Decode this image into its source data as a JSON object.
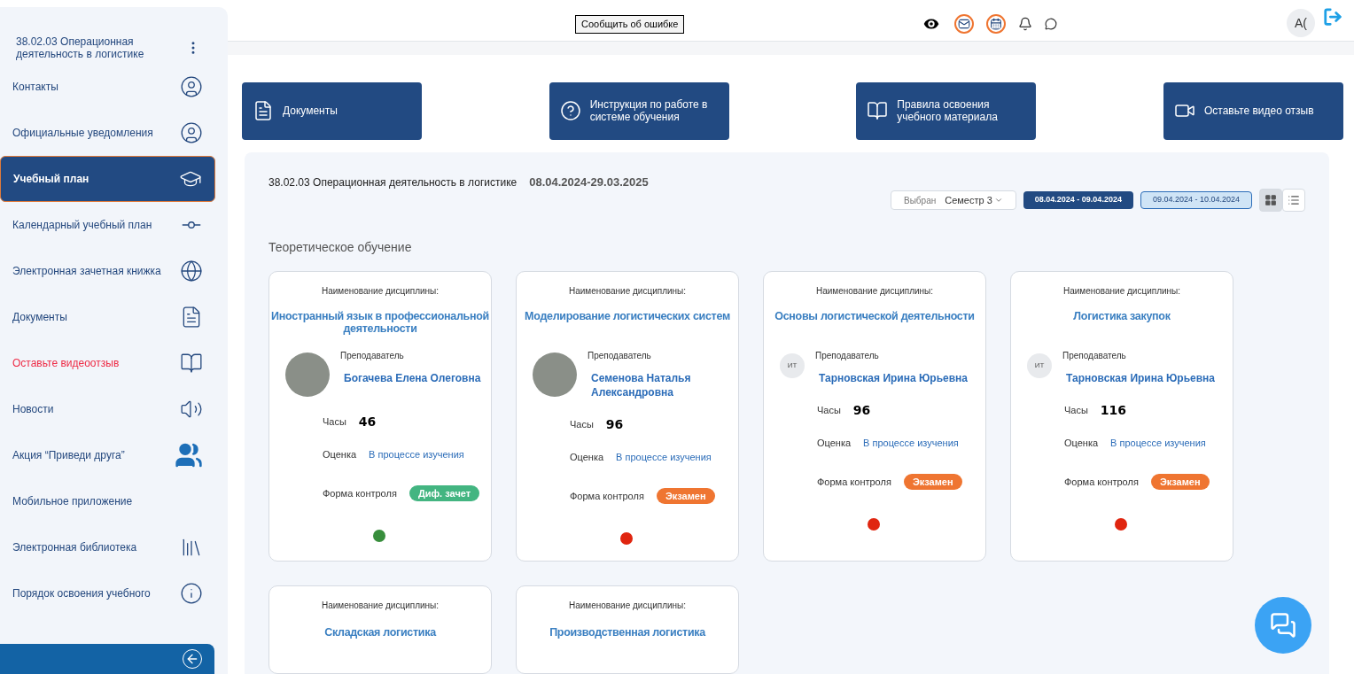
{
  "sidebar": {
    "program": "38.02.03 Операционная деятельность в логистике",
    "items": [
      {
        "label": "Контакты",
        "selected": false,
        "color": "#24487e"
      },
      {
        "label": "Официальные уведомления",
        "selected": false,
        "color": "#24487e"
      },
      {
        "label": "Учебный план",
        "selected": true,
        "color": "#ffffff"
      },
      {
        "label": "Календарный учебный план",
        "selected": false,
        "color": "#24487e"
      },
      {
        "label": "Электронная зачетная книжка",
        "selected": false,
        "color": "#24487e"
      },
      {
        "label": "Документы",
        "selected": false,
        "color": "#24487e"
      },
      {
        "label": "Оставьте видеоотзыв",
        "selected": false,
        "color": "#ee2a45"
      },
      {
        "label": "Новости",
        "selected": false,
        "color": "#24487e"
      },
      {
        "label": "Акция “Приведи друга”",
        "selected": false,
        "color": "#24487e"
      },
      {
        "label": "Мобильное приложение",
        "selected": false,
        "color": "#24487e"
      },
      {
        "label": "Электронная библиотека",
        "selected": false,
        "color": "#24487e"
      },
      {
        "label": "Порядок освоения учебного",
        "selected": false,
        "color": "#24487e"
      }
    ]
  },
  "header": {
    "report_button": "Сообщить об ошибке",
    "avatar": "А("
  },
  "quick_links": [
    {
      "label": "Документы"
    },
    {
      "label": "Инструкция по работе в системе обучения"
    },
    {
      "label": "Правила освоения учебного материала"
    },
    {
      "label": "Оставьте видео отзыв"
    }
  ],
  "plan": {
    "program": "38.02.03 Операционная деятельность в логистике",
    "period": "08.04.2024-29.03.2025",
    "semester_label": "Выбран",
    "semester": "Семестр 3",
    "ranges": [
      {
        "label": "08.04.2024 - 09.04.2024",
        "selected": true
      },
      {
        "label": "09.04.2024 - 10.04.2024",
        "selected": false
      }
    ],
    "views": [
      {
        "kind": "grid",
        "selected": true
      },
      {
        "kind": "list",
        "selected": false
      }
    ],
    "section": "Теоретическое обучение",
    "cards": [
      {
        "name_label": "Наименование дисциплины:",
        "name": "Иностранный язык в профессиональной деятельности",
        "teacher_label": "Преподаватель",
        "teacher": "Богачева Елена Олеговна",
        "hours_label": "Часы",
        "hours": "46",
        "grade_label": "Оценка",
        "grade": "В процессе изучения",
        "control_label": "Форма контроля",
        "control": {
          "label": "Диф. зачет",
          "color": "#43b581"
        },
        "status": {
          "color": "#388e3c"
        }
      },
      {
        "name_label": "Наименование дисциплины:",
        "name": "Моделирование логистических систем",
        "teacher_label": "Преподаватель",
        "teacher": "Семенова Наталья Александровна",
        "hours_label": "Часы",
        "hours": "96",
        "grade_label": "Оценка",
        "grade": "В процессе изучения",
        "control_label": "Форма контроля",
        "control": {
          "label": "Экзамен",
          "color": "#ef7531"
        },
        "status": {
          "color": "#e0250f"
        }
      },
      {
        "name_label": "Наименование дисциплины:",
        "name": "Основы логистической деятельности",
        "teacher_label": "Преподаватель",
        "teacher": "Тарновская Ирина Юрьевна",
        "initials": "ИТ",
        "hours_label": "Часы",
        "hours": "96",
        "grade_label": "Оценка",
        "grade": "В процессе изучения",
        "control_label": "Форма контроля",
        "control": {
          "label": "Экзамен",
          "color": "#ef7531"
        },
        "status": {
          "color": "#e0250f"
        }
      },
      {
        "name_label": "Наименование дисциплины:",
        "name": "Логистика закупок",
        "teacher_label": "Преподаватель",
        "teacher": "Тарновская Ирина Юрьевна",
        "initials": "ИТ",
        "hours_label": "Часы",
        "hours": "116",
        "grade_label": "Оценка",
        "grade": "В процессе изучения",
        "control_label": "Форма контроля",
        "control": {
          "label": "Экзамен",
          "color": "#ef7531"
        },
        "status": {
          "color": "#e0250f"
        }
      },
      {
        "name_label": "Наименование дисциплины:",
        "name": "Складская логистика"
      },
      {
        "name_label": "Наименование дисциплины:",
        "name": "Производственная логистика"
      }
    ]
  }
}
